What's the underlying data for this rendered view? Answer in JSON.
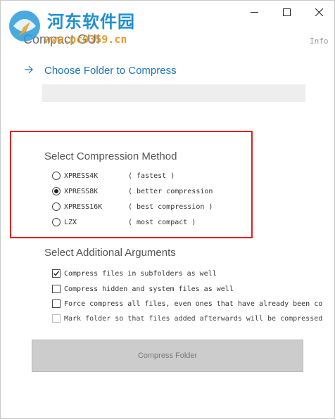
{
  "window": {
    "title": "Compact GUI",
    "info_label": "Info"
  },
  "watermark": {
    "site_name": "河东软件园",
    "url_text": "www.pc0359.cn"
  },
  "choose_folder": {
    "label": "Choose Folder to Compress",
    "path_value": ""
  },
  "compression_method": {
    "heading": "Select Compression Method",
    "options": [
      {
        "name": "XPRESS4K",
        "desc": "( fastest )",
        "checked": false
      },
      {
        "name": "XPRESS8K",
        "desc": "( better compression",
        "checked": true
      },
      {
        "name": "XPRESS16K",
        "desc": "( best compression )",
        "checked": false
      },
      {
        "name": "LZX",
        "desc": "( most compact )",
        "checked": false
      }
    ]
  },
  "additional_arguments": {
    "heading": "Select Additional Arguments",
    "options": [
      {
        "label": "Compress files in subfolders as well",
        "checked": true,
        "enabled": true
      },
      {
        "label": "Compress hidden and system files as well",
        "checked": false,
        "enabled": true
      },
      {
        "label": "Force compress all files, even ones that have already been co",
        "checked": false,
        "enabled": true
      },
      {
        "label": "Mark folder so that files added afterwards will be compressed",
        "checked": false,
        "enabled": false
      }
    ]
  },
  "actions": {
    "compress_label": "Compress Folder"
  },
  "colors": {
    "accent": "#1e73be",
    "highlight": "#e02020",
    "watermark_blue": "#1f8fd1",
    "watermark_orange": "#e3921b"
  }
}
